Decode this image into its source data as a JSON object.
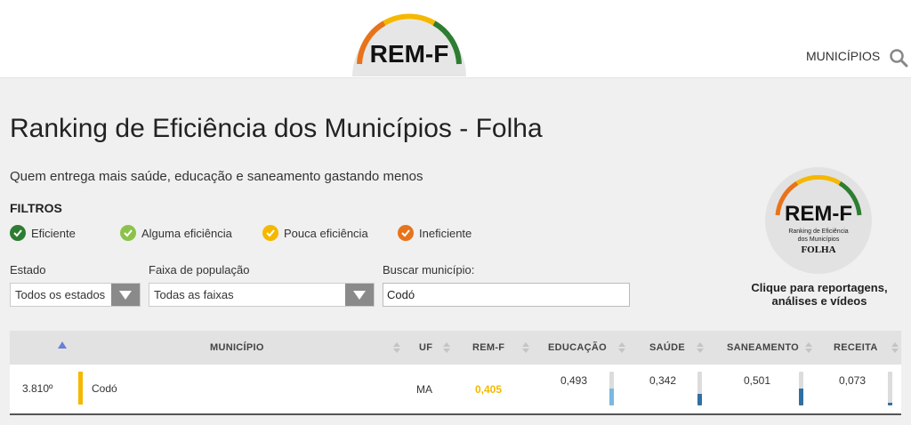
{
  "header": {
    "logo_text": "REM-F",
    "nav_link": "MUNICÍPIOS"
  },
  "page": {
    "title": "Ranking de Eficiência dos Municípios - Folha",
    "subtitle": "Quem entrega mais saúde, educação e saneamento gastando menos"
  },
  "filters": {
    "title": "FILTROS",
    "legend": [
      {
        "label": "Eficiente",
        "color": "#2e7d32"
      },
      {
        "label": "Alguma eficiência",
        "color": "#8bc34a"
      },
      {
        "label": "Pouca eficiência",
        "color": "#f5b800"
      },
      {
        "label": "Ineficiente",
        "color": "#e8731a"
      }
    ],
    "estado": {
      "label": "Estado",
      "value": "Todos os estados"
    },
    "faixa": {
      "label": "Faixa de população",
      "value": "Todas as faixas"
    },
    "busca": {
      "label": "Buscar município:",
      "value": "Codó"
    }
  },
  "promo": {
    "logo_text": "REM-F",
    "logo_sub1": "Ranking de Eficiência",
    "logo_sub2": "dos Municípios",
    "logo_brand": "FOLHA",
    "caption_line1": "Clique para reportagens,",
    "caption_line2": "análises e vídeos"
  },
  "table": {
    "headers": {
      "municipio": "MUNICÍPIO",
      "uf": "UF",
      "remf": "REM-F",
      "educacao": "EDUCAÇÃO",
      "saude": "SAÚDE",
      "saneamento": "SANEAMENTO",
      "receita": "RECEITA"
    },
    "rows": [
      {
        "rank": "3.810º",
        "municipio": "Codó",
        "uf": "MA",
        "remf": "0,405",
        "remf_color": "#f5b800",
        "educacao": "0,493",
        "educacao_level": 0.493,
        "saude": "0,342",
        "saude_level": 0.342,
        "saneamento": "0,501",
        "saneamento_level": 0.501,
        "receita": "0,073",
        "receita_level": 0.073
      }
    ]
  },
  "colors": {
    "gauge_orange": "#e8731a",
    "gauge_yellow": "#f5b800",
    "gauge_green": "#2e7d32",
    "bar_light": "#7ab8e0",
    "bar_dark": "#2f6fa3"
  }
}
